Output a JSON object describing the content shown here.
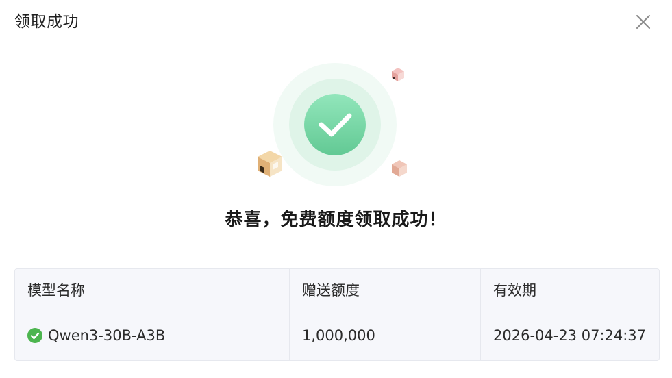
{
  "dialog": {
    "title": "领取成功",
    "close_icon": "close-icon"
  },
  "illustration": {
    "icon": "success-check-icon",
    "accent_color": "#6fd3a0"
  },
  "message": "恭喜，免费额度领取成功！",
  "table": {
    "headers": [
      "模型名称",
      "赠送额度",
      "有效期"
    ],
    "rows": [
      {
        "status_icon": "check-circle-icon",
        "status_color": "#4cb54f",
        "model": "Qwen3-30B-A3B",
        "quota": "1,000,000",
        "expires": "2026-04-23 07:24:37"
      }
    ]
  }
}
